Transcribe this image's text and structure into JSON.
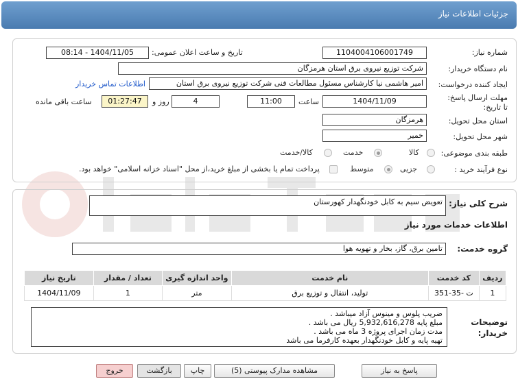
{
  "header": {
    "title": "جزئیات اطلاعات نیاز"
  },
  "form": {
    "need_number_label": "شماره نیاز:",
    "need_number": "1104004106001749",
    "announce_label": "تاریخ و ساعت اعلان عمومی:",
    "announce_value": "1404/11/05 - 08:14",
    "buyer_org_label": "نام دستگاه خریدار:",
    "buyer_org": "شرکت توزیع نیروی برق استان هرمزگان",
    "creator_label": "ایجاد کننده درخواست:",
    "creator": "امیر هاشمی نیا کارشناس مسئول مطالعات فنی شرکت توزیع نیروی برق استان",
    "contact_link": "اطلاعات تماس خریدار",
    "deadline_label": "مهلت ارسال پاسخ: تا تاریخ:",
    "deadline_date": "1404/11/09",
    "time_label": "ساعت",
    "deadline_time": "11:00",
    "days_value": "4",
    "days_label": "روز و",
    "remaining_value": "01:27:47",
    "remaining_label": "ساعت باقی مانده",
    "province_label": "استان محل تحویل:",
    "province": "هرمزگان",
    "city_label": "شهر محل تحویل:",
    "city": "خمیر",
    "category_label": "طبقه بندی موضوعی:",
    "category_options": [
      "کالا",
      "خدمت",
      "کالا/خدمت"
    ],
    "category_selected": 1,
    "process_label": "نوع فرآیند خرید :",
    "process_options": [
      "جزیی",
      "متوسط"
    ],
    "process_selected": 1,
    "payment_note": "پرداخت تمام یا بخشی از مبلغ خرید،از محل \"اسناد خزانه اسلامی\" خواهد بود."
  },
  "summary": {
    "label": "شرح کلی نیاز:",
    "value": "تعویض سیم به کابل خودنگهدار کهورستان"
  },
  "services": {
    "section_title": "اطلاعات خدمات مورد نیاز",
    "group_label": "گروه خدمت:",
    "group_value": "تامین برق، گاز، بخار و تهویه هوا",
    "columns": [
      "ردیف",
      "کد خدمت",
      "نام خدمت",
      "واحد اندازه گیری",
      "تعداد / مقدار",
      "تاریخ نیاز"
    ],
    "rows": [
      [
        "1",
        "ت -35-351",
        "تولید، انتقال و توزیع برق",
        "متر",
        "1",
        "1404/11/09"
      ]
    ]
  },
  "buyer_notes": {
    "label": "توضیحات خریدار:",
    "lines": [
      "ضریب پلوس و مینوس آزاد میباشد .",
      "مبلغ پایه 5,932,616,278 ریال می باشد .",
      "مدت زمان اجرای پروژه 3 ماه می باشد .",
      "تهیه پایه و کابل خودنگهدار بعهده کارفرما می باشد"
    ]
  },
  "buttons": {
    "reply": "پاسخ به نیاز",
    "attachments": "مشاهده مدارک پیوستی (5)",
    "print": "چاپ",
    "back": "بازگشت",
    "exit": "خروج"
  },
  "colors": {
    "header": "#5a8ac0",
    "accent_link": "#1a55c9",
    "remaining_bg": "#fbf5c8"
  }
}
